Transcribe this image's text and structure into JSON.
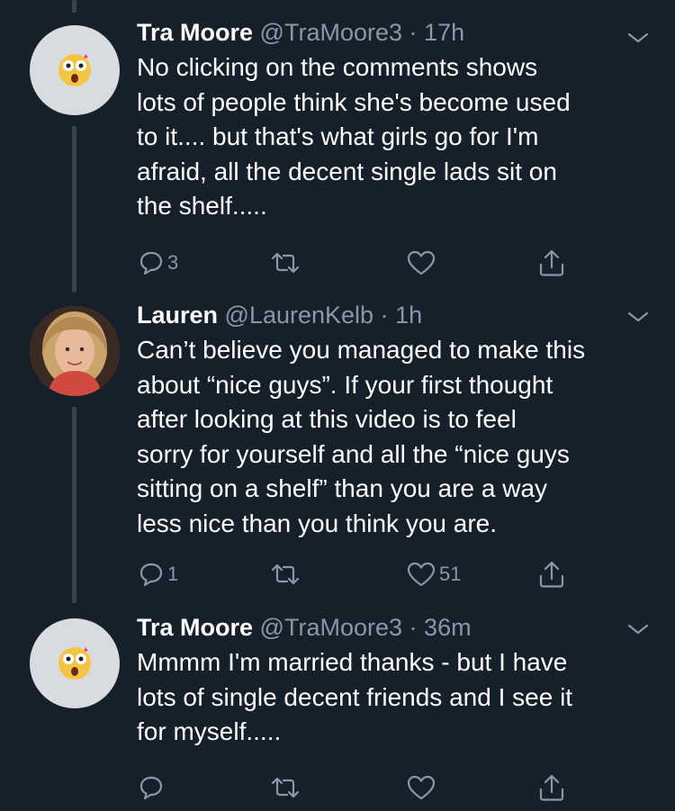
{
  "colors": {
    "background": "#15202b",
    "secondary_text": "#8899a6",
    "thread_line": "#38444d"
  },
  "tweets": [
    {
      "name": "Tra Moore",
      "handle": "@TraMoore3",
      "separator": "·",
      "time": "17h",
      "avatar": "astonished-emoji-avatar",
      "lines": [
        "No clicking on the comments shows",
        "lots of people think she's become used",
        "to it.... but that's what girls go for I'm",
        "afraid, all the decent single lads sit on",
        "the shelf....."
      ],
      "reply_count": "3",
      "like_count": ""
    },
    {
      "name": "Lauren",
      "handle": "@LaurenKelb",
      "separator": "·",
      "time": "1h",
      "avatar": "profile-photo-avatar",
      "lines": [
        "Can’t believe you managed to make this",
        "about “nice guys”. If your first thought",
        "after looking at this video is to feel",
        "sorry for yourself and all the “nice guys",
        "sitting on a shelf” than you are a way",
        "less nice than you think you are."
      ],
      "reply_count": "1",
      "like_count": "51"
    },
    {
      "name": "Tra Moore",
      "handle": "@TraMoore3",
      "separator": "·",
      "time": "36m",
      "avatar": "astonished-emoji-avatar",
      "lines": [
        "Mmmm I'm married thanks - but I have",
        "lots of single decent friends and I see it",
        "for myself....."
      ],
      "reply_count": "",
      "like_count": ""
    }
  ]
}
